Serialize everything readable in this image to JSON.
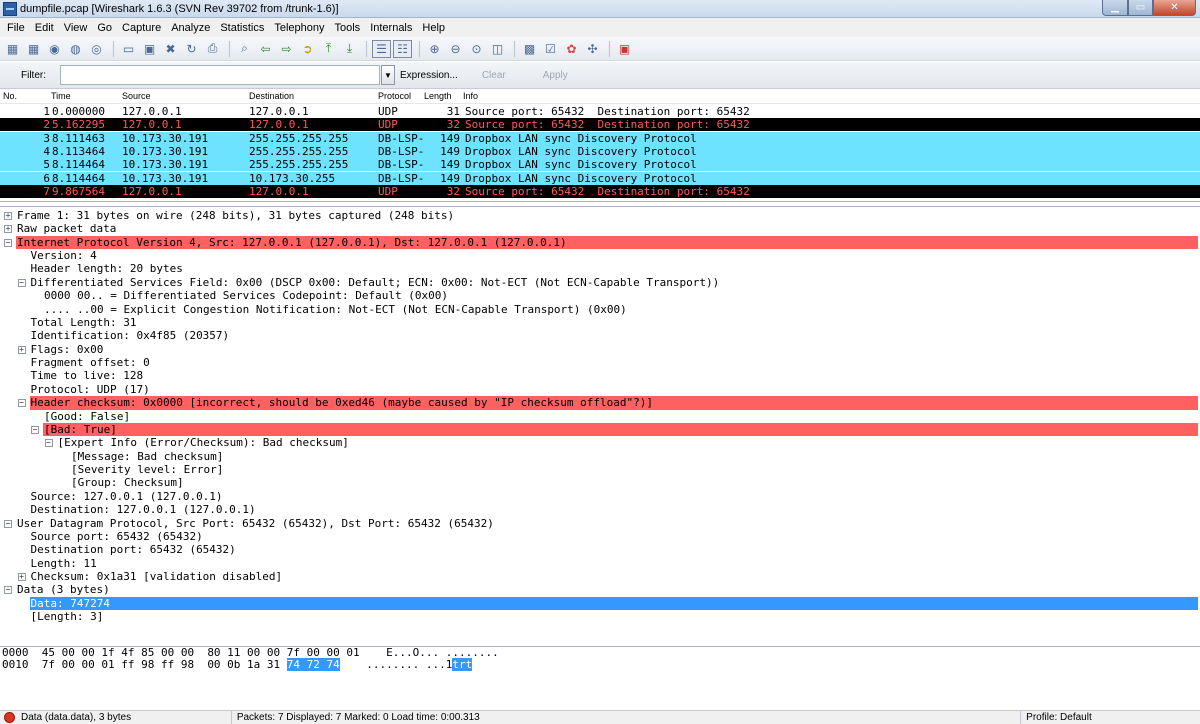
{
  "window": {
    "title": "dumpfile.pcap   [Wireshark 1.6.3  (SVN Rev 39702 from /trunk-1.6)]"
  },
  "menu": [
    "File",
    "Edit",
    "View",
    "Go",
    "Capture",
    "Analyze",
    "Statistics",
    "Telephony",
    "Tools",
    "Internals",
    "Help"
  ],
  "filter": {
    "label": "Filter:",
    "value": "",
    "expression": "Expression...",
    "clear": "Clear",
    "apply": "Apply"
  },
  "packet_list": {
    "columns": [
      "No.",
      "Time",
      "Source",
      "Destination",
      "Protocol",
      "Length",
      "Info"
    ],
    "rows": [
      {
        "no": "1",
        "time": "0.000000",
        "src": "127.0.0.1",
        "dst": "127.0.0.1",
        "proto": "UDP",
        "len": "31",
        "info": "Source port: 65432  Destination port: 65432",
        "style": "udp"
      },
      {
        "no": "2",
        "time": "5.162295",
        "src": "127.0.0.1",
        "dst": "127.0.0.1",
        "proto": "UDP",
        "len": "32",
        "info": "Source port: 65432  Destination port: 65432",
        "style": "black"
      },
      {
        "no": "3",
        "time": "8.111463",
        "src": "10.173.30.191",
        "dst": "255.255.255.255",
        "proto": "DB-LSP-",
        "len": "149",
        "info": "Dropbox LAN sync Discovery Protocol",
        "style": "cyan"
      },
      {
        "no": "4",
        "time": "8.113464",
        "src": "10.173.30.191",
        "dst": "255.255.255.255",
        "proto": "DB-LSP-",
        "len": "149",
        "info": "Dropbox LAN sync Discovery Protocol",
        "style": "cyan"
      },
      {
        "no": "5",
        "time": "8.114464",
        "src": "10.173.30.191",
        "dst": "255.255.255.255",
        "proto": "DB-LSP-",
        "len": "149",
        "info": "Dropbox LAN sync Discovery Protocol",
        "style": "cyan"
      },
      {
        "no": "6",
        "time": "8.114464",
        "src": "10.173.30.191",
        "dst": "10.173.30.255",
        "proto": "DB-LSP-",
        "len": "149",
        "info": "Dropbox LAN sync Discovery Protocol",
        "style": "cyan"
      },
      {
        "no": "7",
        "time": "9.867564",
        "src": "127.0.0.1",
        "dst": "127.0.0.1",
        "proto": "UDP",
        "len": "32",
        "info": "Source port: 65432  Destination port: 65432",
        "style": "black"
      }
    ]
  },
  "details": [
    {
      "text": "Frame 1: 31 bytes on wire (248 bits), 31 bytes captured (248 bits)",
      "indent": 0,
      "exp": "+",
      "hl": ""
    },
    {
      "text": "Raw packet data",
      "indent": 0,
      "exp": "+",
      "hl": ""
    },
    {
      "text": "Internet Protocol Version 4, Src: 127.0.0.1 (127.0.0.1), Dst: 127.0.0.1 (127.0.0.1)",
      "indent": 0,
      "exp": "-",
      "hl": "red"
    },
    {
      "text": "Version: 4",
      "indent": 1,
      "exp": "",
      "hl": ""
    },
    {
      "text": "Header length: 20 bytes",
      "indent": 1,
      "exp": "",
      "hl": ""
    },
    {
      "text": "Differentiated Services Field: 0x00 (DSCP 0x00: Default; ECN: 0x00: Not-ECT (Not ECN-Capable Transport))",
      "indent": 1,
      "exp": "-",
      "hl": ""
    },
    {
      "text": "0000 00.. = Differentiated Services Codepoint: Default (0x00)",
      "indent": 2,
      "exp": "",
      "hl": ""
    },
    {
      "text": ".... ..00 = Explicit Congestion Notification: Not-ECT (Not ECN-Capable Transport) (0x00)",
      "indent": 2,
      "exp": "",
      "hl": ""
    },
    {
      "text": "Total Length: 31",
      "indent": 1,
      "exp": "",
      "hl": ""
    },
    {
      "text": "Identification: 0x4f85 (20357)",
      "indent": 1,
      "exp": "",
      "hl": ""
    },
    {
      "text": "Flags: 0x00",
      "indent": 1,
      "exp": "+",
      "hl": ""
    },
    {
      "text": "Fragment offset: 0",
      "indent": 1,
      "exp": "",
      "hl": ""
    },
    {
      "text": "Time to live: 128",
      "indent": 1,
      "exp": "",
      "hl": ""
    },
    {
      "text": "Protocol: UDP (17)",
      "indent": 1,
      "exp": "",
      "hl": ""
    },
    {
      "text": "Header checksum: 0x0000 [incorrect, should be 0xed46 (maybe caused by \"IP checksum offload\"?)]",
      "indent": 1,
      "exp": "-",
      "hl": "red"
    },
    {
      "text": "[Good: False]",
      "indent": 2,
      "exp": "",
      "hl": ""
    },
    {
      "text": "[Bad: True]",
      "indent": 2,
      "exp": "-",
      "hl": "red"
    },
    {
      "text": "[Expert Info (Error/Checksum): Bad checksum]",
      "indent": 3,
      "exp": "-",
      "hl": ""
    },
    {
      "text": "[Message: Bad checksum]",
      "indent": 4,
      "exp": "",
      "hl": ""
    },
    {
      "text": "[Severity level: Error]",
      "indent": 4,
      "exp": "",
      "hl": ""
    },
    {
      "text": "[Group: Checksum]",
      "indent": 4,
      "exp": "",
      "hl": ""
    },
    {
      "text": "Source: 127.0.0.1 (127.0.0.1)",
      "indent": 1,
      "exp": "",
      "hl": ""
    },
    {
      "text": "Destination: 127.0.0.1 (127.0.0.1)",
      "indent": 1,
      "exp": "",
      "hl": ""
    },
    {
      "text": "User Datagram Protocol, Src Port: 65432 (65432), Dst Port: 65432 (65432)",
      "indent": 0,
      "exp": "-",
      "hl": ""
    },
    {
      "text": "Source port: 65432 (65432)",
      "indent": 1,
      "exp": "",
      "hl": ""
    },
    {
      "text": "Destination port: 65432 (65432)",
      "indent": 1,
      "exp": "",
      "hl": ""
    },
    {
      "text": "Length: 11",
      "indent": 1,
      "exp": "",
      "hl": ""
    },
    {
      "text": "Checksum: 0x1a31 [validation disabled]",
      "indent": 1,
      "exp": "+",
      "hl": ""
    },
    {
      "text": "Data (3 bytes)",
      "indent": 0,
      "exp": "-",
      "hl": ""
    },
    {
      "text": "Data: 747274",
      "indent": 1,
      "exp": "",
      "hl": "blue"
    },
    {
      "text": "[Length: 3]",
      "indent": 1,
      "exp": "",
      "hl": ""
    }
  ],
  "bytes": [
    {
      "offset": "0000",
      "hex": "45 00 00 1f 4f 85 00 00  80 11 00 00 7f 00 00 01",
      "hex_sel": "",
      "ascii": "E...O... ........",
      "ascii_sel": ""
    },
    {
      "offset": "0010",
      "hex": "7f 00 00 01 ff 98 ff 98  00 0b 1a 31 ",
      "hex_sel": "74 72 74",
      "ascii": "........ ...1",
      "ascii_sel": "trt"
    }
  ],
  "status": {
    "field": "Data (data.data), 3 bytes",
    "stats": "Packets: 7 Displayed: 7 Marked: 0 Load time: 0:00.313",
    "profile": "Profile: Default"
  },
  "colors": {
    "udp_black_fg": "#ff5a5a",
    "dropbox_bg": "#6ee3ff",
    "error_bg": "#ff6060",
    "selection": "#3399ff"
  }
}
